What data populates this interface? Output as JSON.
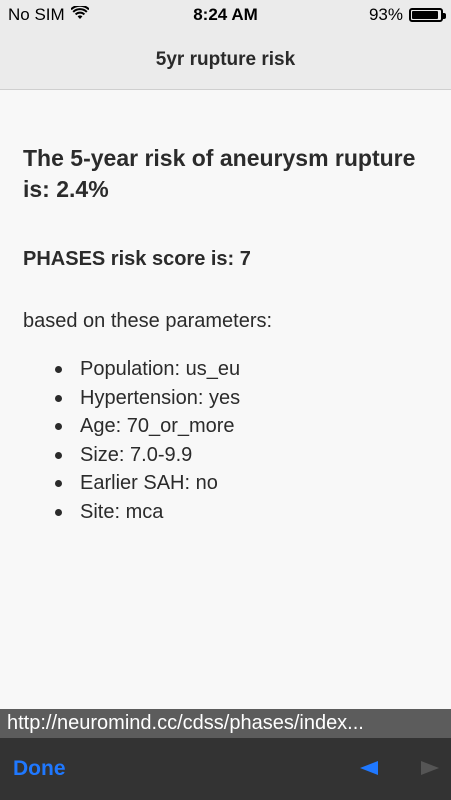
{
  "status_bar": {
    "carrier": "No SIM",
    "time": "8:24 AM",
    "battery_percent": "93%",
    "battery_level": 0.93
  },
  "nav": {
    "title": "5yr rupture risk"
  },
  "content": {
    "headline": "The 5-year risk of aneurysm rupture is: 2.4%",
    "score": "PHASES risk score is: 7",
    "based_on": "based on these parameters:",
    "parameters": [
      "Population: us_eu",
      "Hypertension: yes",
      "Age: 70_or_more",
      "Size: 7.0-9.9",
      "Earlier SAH: no",
      "Site: mca"
    ]
  },
  "url_bar": {
    "url": "http://neuromind.cc/cdss/phases/index..."
  },
  "toolbar": {
    "done_label": "Done",
    "back_icon": "back-arrow-icon",
    "forward_icon": "forward-arrow-icon",
    "accent_color": "#1f78ff"
  }
}
